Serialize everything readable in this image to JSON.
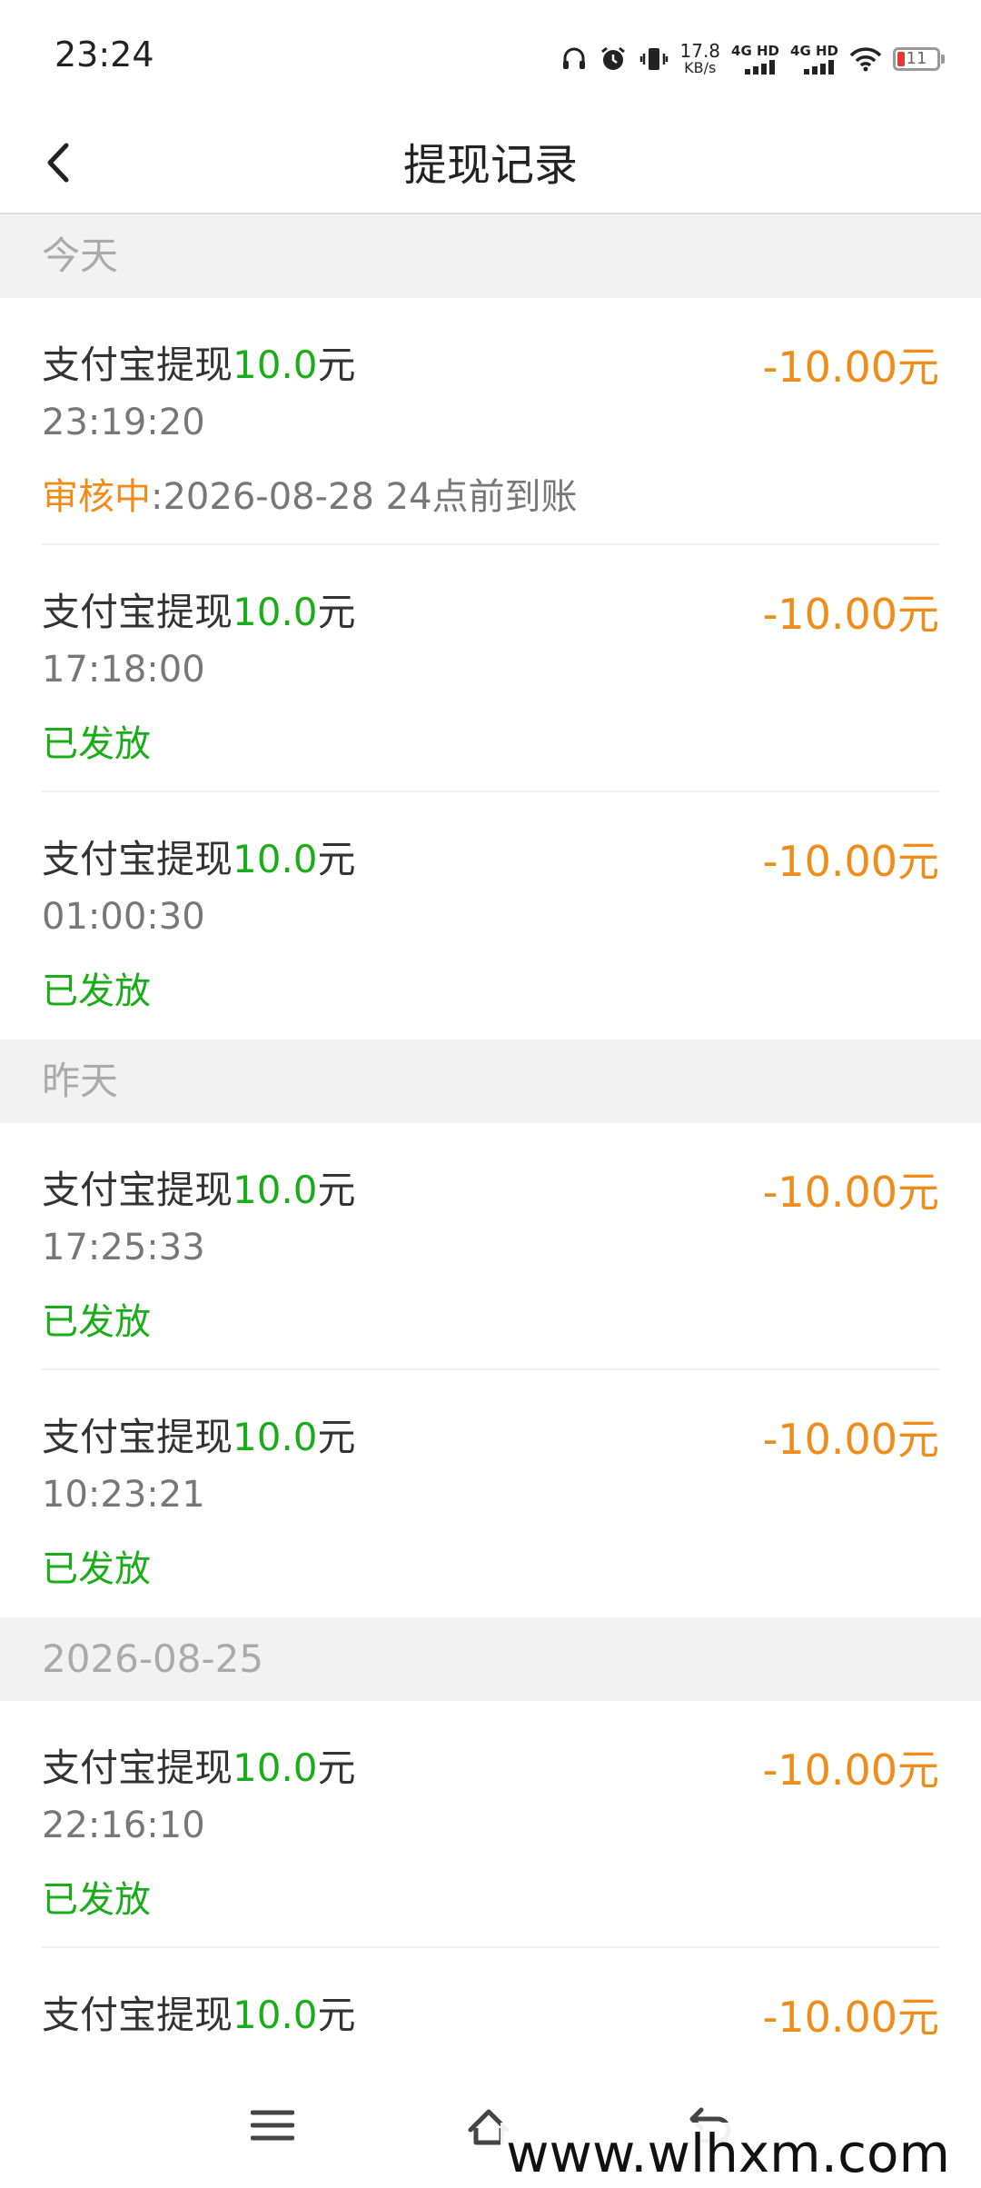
{
  "status_bar": {
    "time": "23:24",
    "net_speed_value": "17.8",
    "net_speed_unit": "KB/s",
    "sim1_label": "4G HD",
    "sim2_label": "4G HD",
    "battery_level": "11",
    "icons": [
      "headphones-icon",
      "alarm-icon",
      "vibrate-icon",
      "signal-icon",
      "wifi-icon",
      "battery-icon"
    ]
  },
  "header": {
    "title": "提现记录"
  },
  "sections": [
    {
      "label": "今天",
      "records": [
        {
          "title_prefix": "支付宝提现",
          "title_amount": "10.0",
          "title_suffix": "元",
          "amount": "-10.00元",
          "time": "23:19:20",
          "status": "审核中",
          "status_detail": ":2026-08-28 24点前到账"
        },
        {
          "title_prefix": "支付宝提现",
          "title_amount": "10.0",
          "title_suffix": "元",
          "amount": "-10.00元",
          "time": "17:18:00",
          "status": "已发放",
          "status_detail": ""
        },
        {
          "title_prefix": "支付宝提现",
          "title_amount": "10.0",
          "title_suffix": "元",
          "amount": "-10.00元",
          "time": "01:00:30",
          "status": "已发放",
          "status_detail": ""
        }
      ]
    },
    {
      "label": "昨天",
      "records": [
        {
          "title_prefix": "支付宝提现",
          "title_amount": "10.0",
          "title_suffix": "元",
          "amount": "-10.00元",
          "time": "17:25:33",
          "status": "已发放",
          "status_detail": ""
        },
        {
          "title_prefix": "支付宝提现",
          "title_amount": "10.0",
          "title_suffix": "元",
          "amount": "-10.00元",
          "time": "10:23:21",
          "status": "已发放",
          "status_detail": ""
        }
      ]
    },
    {
      "label": "2026-08-25",
      "records": [
        {
          "title_prefix": "支付宝提现",
          "title_amount": "10.0",
          "title_suffix": "元",
          "amount": "-10.00元",
          "time": "22:16:10",
          "status": "已发放",
          "status_detail": ""
        },
        {
          "title_prefix": "支付宝提现",
          "title_amount": "10.0",
          "title_suffix": "元",
          "amount": "-10.00元",
          "time": "",
          "status": "",
          "status_detail": ""
        }
      ]
    }
  ],
  "bottom_nav": {
    "icons": [
      "menu-icon",
      "home-icon",
      "back-icon"
    ]
  },
  "watermark": "www.wlhxm.com",
  "colors": {
    "accent_green": "#1aad19",
    "amount_orange": "#f08c1a",
    "section_bg": "#f2f2f2"
  }
}
